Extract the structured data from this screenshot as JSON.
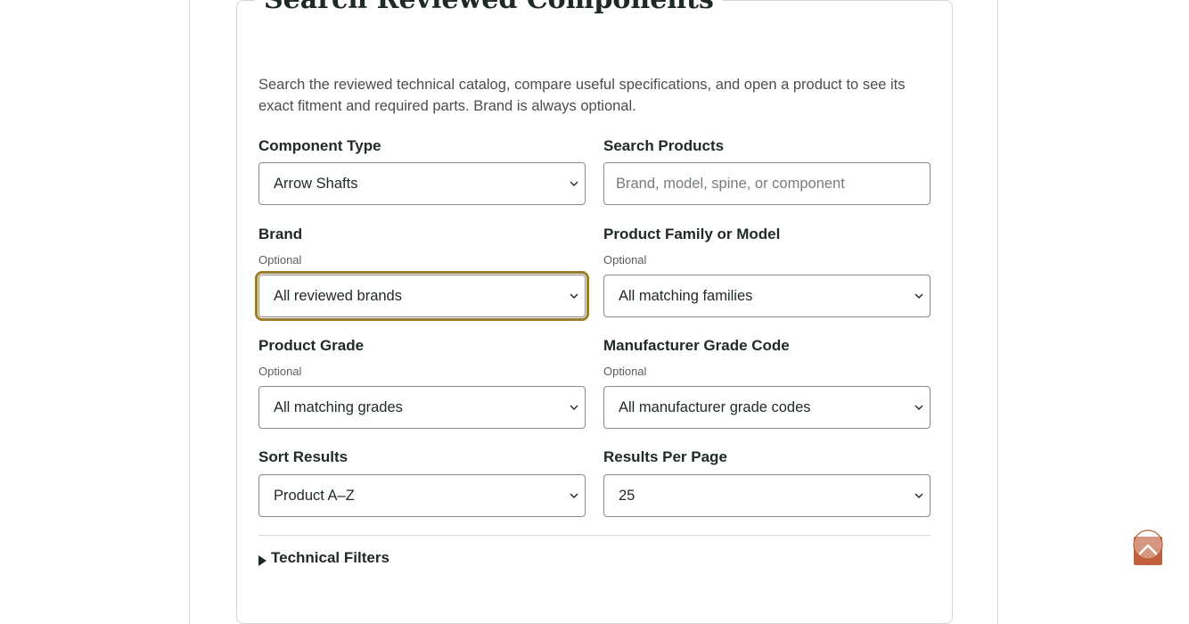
{
  "card": {
    "title": "Search Reviewed Components",
    "intro": "Search the reviewed technical catalog, compare useful specifications, and open a product to see its exact fitment and required parts. Brand is always optional."
  },
  "fields": {
    "component_type": {
      "label": "Component Type",
      "value": "Arrow Shafts"
    },
    "search_products": {
      "label": "Search Products",
      "placeholder": "Brand, model, spine, or component"
    },
    "brand": {
      "label": "Brand",
      "hint": "Optional",
      "value": "All reviewed brands"
    },
    "family": {
      "label": "Product Family or Model",
      "hint": "Optional",
      "value": "All matching families"
    },
    "grade": {
      "label": "Product Grade",
      "hint": "Optional",
      "value": "All matching grades"
    },
    "mfr_grade": {
      "label": "Manufacturer Grade Code",
      "hint": "Optional",
      "value": "All manufacturer grade codes"
    },
    "sort": {
      "label": "Sort Results",
      "value": "Product A–Z"
    },
    "per_page": {
      "label": "Results Per Page",
      "value": "25"
    }
  },
  "technical_filters": {
    "label": "Technical Filters"
  },
  "icons": {
    "select_chevron": "chevron-down-icon",
    "disclosure": "triangle-right-icon",
    "back_to_top": "chevron-up-icon"
  },
  "colors": {
    "focus_ring": "#9a7d2e",
    "back_to_top": "#c0603c"
  }
}
